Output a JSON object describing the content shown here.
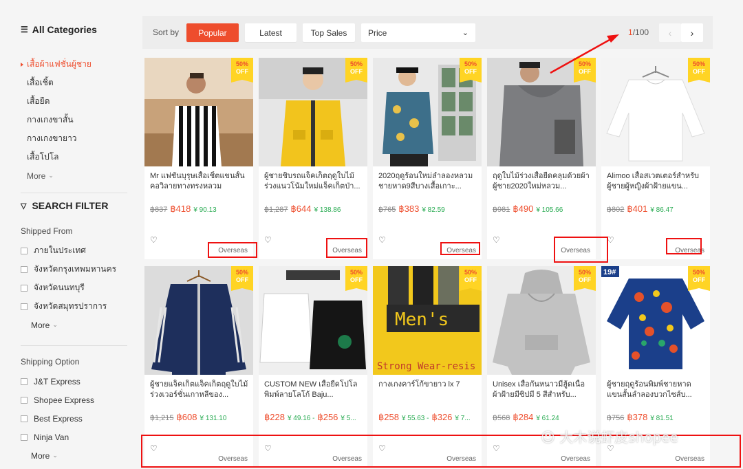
{
  "sidebar": {
    "all_categories": "All Categories",
    "categories": [
      "เสื้อผ้าแฟชั่นผู้ชาย",
      "เสื้อเชิ้ต",
      "เสื้อยืด",
      "กางเกงขาสั้น",
      "กางเกงขายาว",
      "เสื้อโปโล"
    ],
    "more": "More",
    "search_filter": "SEARCH FILTER",
    "shipped_from": {
      "title": "Shipped From",
      "options": [
        "ภายในประเทศ",
        "จังหวัดกรุงเทพมหานคร",
        "จังหวัดนนทบุรี",
        "จังหวัดสมุทรปราการ"
      ],
      "more": "More"
    },
    "shipping_option": {
      "title": "Shipping Option",
      "options": [
        "J&T Express",
        "Shopee Express",
        "Best Express",
        "Ninja Van"
      ],
      "more": "More"
    }
  },
  "sortbar": {
    "label": "Sort by",
    "buttons": [
      "Popular",
      "Latest",
      "Top Sales"
    ],
    "price": "Price",
    "page_current": "1",
    "page_total": "/100"
  },
  "badge": {
    "pct": "50%",
    "off": "OFF"
  },
  "products": [
    {
      "name": "Mr แฟชั่นบุรุษเสื้อเชิ้ตแขนสั้นคอวิลายทางทรงหลวม",
      "old": "฿837",
      "price": "฿418",
      "cny": "¥ 90.13",
      "origin": "Overseas"
    },
    {
      "name": "ผู้ชายชิบรถแจ็คเก็ตฤดูใบไม้ร่วงแนวโน้มใหม่แจ็คเก็ตป่า...",
      "old": "฿1,287",
      "price": "฿644",
      "cny": "¥ 138.86",
      "origin": "Overseas"
    },
    {
      "name": "2020ฤดูร้อนใหม่ลำลองหลวมชายหาด9สีบางเสื้อเกาะ...",
      "old": "฿765",
      "price": "฿383",
      "cny": "¥ 82.59",
      "origin": "Overseas"
    },
    {
      "name": "ฤดูใบไม้ร่วงเสื้อยืดคลุมด้วยผ้าผู้ชาย2020ใหม่หลวม...",
      "old": "฿981",
      "price": "฿490",
      "cny": "¥ 105.66",
      "origin": "Overseas"
    },
    {
      "name": "Alimoo เสื้อสเวตเตอร์สำหรับผู้ชายผู้หญิงผ้าฝ้ายแขน...",
      "old": "฿802",
      "price": "฿401",
      "cny": "¥ 86.47",
      "origin": "Overseas"
    },
    {
      "name": "ผู้ชายแจ็คเก็ตแจ็คเก็ตฤดูใบไม้ร่วงเวอร์ชั่นเกาหลีของ...",
      "old": "฿1,215",
      "price": "฿608",
      "cny": "¥ 131.10",
      "origin": "Overseas"
    },
    {
      "name": "CUSTOM NEW เสื้อยืดโปโลพิมพ์ลายโลโก้ Baju...",
      "old": "",
      "price": "฿228",
      "cny": "¥ 49.16 -",
      "price2": "฿256",
      "cny2": "¥ 5...",
      "origin": "Overseas"
    },
    {
      "name": "กางเกงคาร์โก้ขายาว lx 7",
      "old": "",
      "price": "฿258",
      "cny": "¥ 55.63 -",
      "price2": "฿326",
      "cny2": "¥ 7...",
      "origin": "Overseas"
    },
    {
      "name": "Unisex เสื้อกันหนาวมีฮู้ดเนื้อผ้าฝ้ายมีซิปมี 5 สีสำหรับ...",
      "old": "฿568",
      "price": "฿284",
      "cny": "¥ 61.24",
      "origin": "Overseas"
    },
    {
      "name": "ผู้ชายฤดูร้อนพิมพ์ชายหาดแขนสั้นลำลองบวกไซส์บ...",
      "old": "฿756",
      "price": "฿378",
      "cny": "¥ 81.51",
      "origin": "Overseas"
    }
  ],
  "image_texts": {
    "mens": "Men's",
    "strong": "Strong Wear-resis",
    "tag19": "19#"
  },
  "watermark": "大木说虾皮shopee",
  "colors": {
    "accent": "#ee4d2d",
    "badge": "#ffd424",
    "cny": "#26aa50",
    "annotation": "#e11111"
  }
}
